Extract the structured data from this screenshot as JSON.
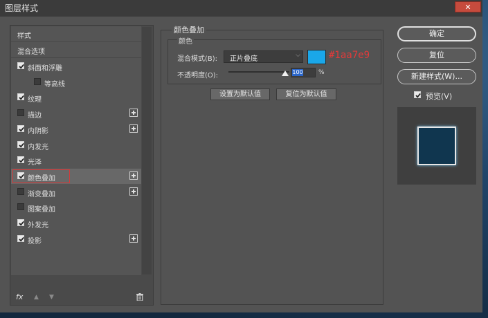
{
  "window": {
    "title": "图层样式",
    "close": "✕"
  },
  "styles_list": {
    "header": "样式",
    "blend_options": "混合选项",
    "items": [
      {
        "label": "斜面和浮雕",
        "checked": true,
        "plus": false
      },
      {
        "label": "等高线",
        "checked": false,
        "plus": false
      },
      {
        "label": "纹理",
        "checked": true,
        "plus": false
      },
      {
        "label": "描边",
        "checked": false,
        "plus": true
      },
      {
        "label": "内阴影",
        "checked": true,
        "plus": true
      },
      {
        "label": "内发光",
        "checked": true,
        "plus": false
      },
      {
        "label": "光泽",
        "checked": true,
        "plus": false
      },
      {
        "label": "颜色叠加",
        "checked": true,
        "plus": true
      },
      {
        "label": "渐变叠加",
        "checked": false,
        "plus": true
      },
      {
        "label": "图案叠加",
        "checked": false,
        "plus": false
      },
      {
        "label": "外发光",
        "checked": true,
        "plus": false
      },
      {
        "label": "投影",
        "checked": true,
        "plus": true
      }
    ],
    "selected": "颜色叠加",
    "fx_label": "fx"
  },
  "color_overlay": {
    "section_title": "颜色叠加",
    "group_title": "颜色",
    "blend_mode_label": "混合模式(B):",
    "blend_mode_value": "正片叠底",
    "color_hex": "#1aa7e9",
    "color_annotation": "#1aa7e9",
    "opacity_label": "不透明度(O):",
    "opacity_value": "100",
    "opacity_fraction": 1.0,
    "opacity_unit": "%",
    "set_default_label": "设置为默认值",
    "reset_default_label": "复位为默认值"
  },
  "actions": {
    "ok": "确定",
    "reset": "复位",
    "new_style": "新建样式(W)...",
    "preview_label": "预览(V)",
    "preview_checked": true
  },
  "colors": {
    "dialog_bg": "#535353",
    "highlight_border": "#d43a3a",
    "annotation_text": "#e33a3a",
    "swatch": "#1aa7e9"
  }
}
